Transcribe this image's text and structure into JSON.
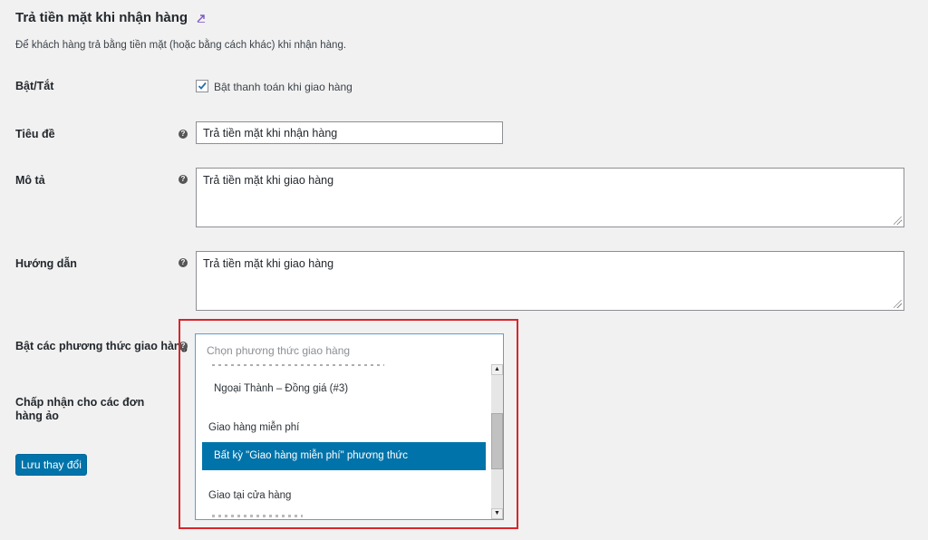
{
  "section": {
    "title": "Trả tiền mặt khi nhận hàng",
    "description": "Để khách hàng trả bằng tiền mặt (hoặc bằng cách khác) khi nhận hàng."
  },
  "fields": {
    "enable": {
      "label": "Bật/Tắt",
      "checkbox_label": "Bật thanh toán khi giao hàng",
      "checked": true
    },
    "title": {
      "label": "Tiêu đề",
      "value": "Trả tiền mặt khi nhận hàng"
    },
    "description": {
      "label": "Mô tả",
      "value": "Trả tiền mặt khi giao hàng"
    },
    "instructions": {
      "label": "Hướng dẫn",
      "value": "Trả tiền mặt khi giao hàng"
    },
    "shipping_methods": {
      "label": "Bật các phương thức giao hàng",
      "placeholder": "Chọn phương thức giao hàng",
      "options": [
        {
          "text": "Ngoại Thành – Đồng giá (#3)",
          "type": "option"
        },
        {
          "text": "Giao hàng miễn phí",
          "type": "group"
        },
        {
          "text": "Bất kỳ \"Giao hàng miễn phí\" phương thức",
          "type": "option",
          "highlighted": true
        },
        {
          "text": "Giao tại cửa hàng",
          "type": "group"
        }
      ]
    },
    "virtual_orders": {
      "label": "Chấp nhận cho các đơn hàng ảo"
    }
  },
  "save_button": {
    "label": "Lưu thay đổi"
  },
  "colors": {
    "accent": "#0073aa",
    "highlight_frame": "#d9252b",
    "page_bg": "#f1f1f1"
  },
  "icons": {
    "title_link": "up-arrow-link-icon",
    "help": "question-circle-icon",
    "checkmark": "checkmark-icon"
  }
}
